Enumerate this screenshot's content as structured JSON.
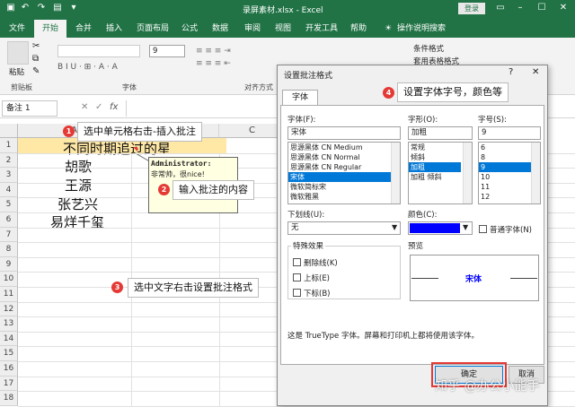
{
  "window": {
    "title": "录屏素材.xlsx - Excel",
    "login": "登录"
  },
  "tabs": [
    {
      "label": "文件"
    },
    {
      "label": "开始"
    },
    {
      "label": "合并"
    },
    {
      "label": "插入"
    },
    {
      "label": "页面布局"
    },
    {
      "label": "公式"
    },
    {
      "label": "数据"
    },
    {
      "label": "审阅"
    },
    {
      "label": "视图"
    },
    {
      "label": "开发工具"
    },
    {
      "label": "帮助"
    },
    {
      "label": "操作说明搜索"
    }
  ],
  "ribbon": {
    "paste": "粘贴",
    "clipboard": "剪贴板",
    "font_group": "字体",
    "align_group": "对齐方式",
    "font_size": "9",
    "cond_format": "条件格式",
    "table_format": "套用表格格式"
  },
  "formula_bar": {
    "namebox": "备注 1",
    "fx": "fx"
  },
  "columns": [
    "A",
    "B",
    "C"
  ],
  "rows": [
    "1",
    "2",
    "3",
    "4",
    "5",
    "6",
    "7",
    "8",
    "9",
    "10",
    "11",
    "12",
    "13",
    "14",
    "15",
    "16",
    "17",
    "18"
  ],
  "cells": {
    "a1": "不同时期追过的星",
    "a2": "胡歌",
    "a3": "王源",
    "a4": "张艺兴",
    "a5": "易烊千玺"
  },
  "comment": {
    "author": "Administrator:",
    "text": "非常帅，很nice!"
  },
  "callouts": [
    {
      "num": "1",
      "text": "选中单元格右击-插入批注"
    },
    {
      "num": "2",
      "text": "输入批注的内容"
    },
    {
      "num": "3",
      "text": "选中文字右击设置批注格式"
    },
    {
      "num": "4",
      "text": "设置字体字号，颜色等"
    }
  ],
  "dialog": {
    "title": "设置批注格式",
    "help": "?",
    "tab": "字体",
    "font_label": "字体(F):",
    "font_value": "宋体",
    "fonts": [
      "思源黑体 CN Medium",
      "思源黑体 CN Normal",
      "思源黑体 CN Regular",
      "宋体",
      "微软简标宋",
      "微软雅黑"
    ],
    "style_label": "字形(O):",
    "style_value": "加粗",
    "styles": [
      "常规",
      "倾斜",
      "加粗",
      "加粗 倾斜"
    ],
    "size_label": "字号(S):",
    "size_value": "9",
    "sizes": [
      "6",
      "8",
      "9",
      "10",
      "11",
      "12"
    ],
    "underline_label": "下划线(U):",
    "underline_value": "无",
    "color_label": "颜色(C):",
    "color_value": "#0000ff",
    "normal_font": "普通字体(N)",
    "effects_label": "特殊效果",
    "strike": "删除线(K)",
    "superscript": "上标(E)",
    "subscript": "下标(B)",
    "preview_label": "预览",
    "preview_text": "宋体",
    "info": "这是 TrueType 字体。屏幕和打印机上都将使用该字体。",
    "ok": "确定",
    "cancel": "取消"
  },
  "watermark": "知乎 @办公小能手",
  "colors": {
    "excel_green": "#217346",
    "accent_red": "#e53935",
    "selection_blue": "#0078d7"
  }
}
